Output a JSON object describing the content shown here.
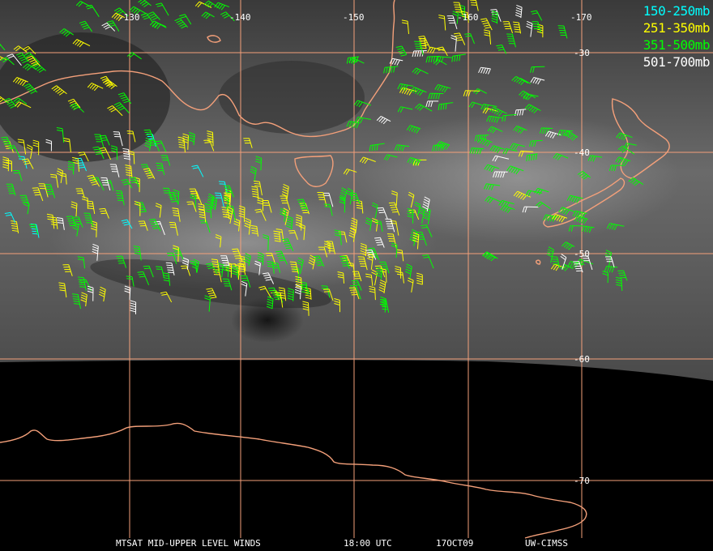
{
  "map": {
    "longitude_labels": [
      "-130",
      "-140",
      "-150",
      "-160",
      "-170"
    ],
    "latitude_labels": [
      "-30",
      "-40",
      "-50",
      "-60",
      "-70"
    ],
    "colors": {
      "background": "#000000",
      "coastline": "#f4a07a",
      "gridlines": "#f4a07a",
      "grid_label": "#ffffff"
    }
  },
  "legend": [
    {
      "label": "150-250mb",
      "color": "#00ffff"
    },
    {
      "label": "251-350mb",
      "color": "#ffff00"
    },
    {
      "label": "351-500mb",
      "color": "#00ff00"
    },
    {
      "label": "501-700mb",
      "color": "#ffffff"
    }
  ],
  "footer": {
    "product": "MTSAT MID-UPPER LEVEL WINDS",
    "time": "18:00 UTC",
    "date": "17OCT09",
    "source": "UW-CIMSS"
  }
}
